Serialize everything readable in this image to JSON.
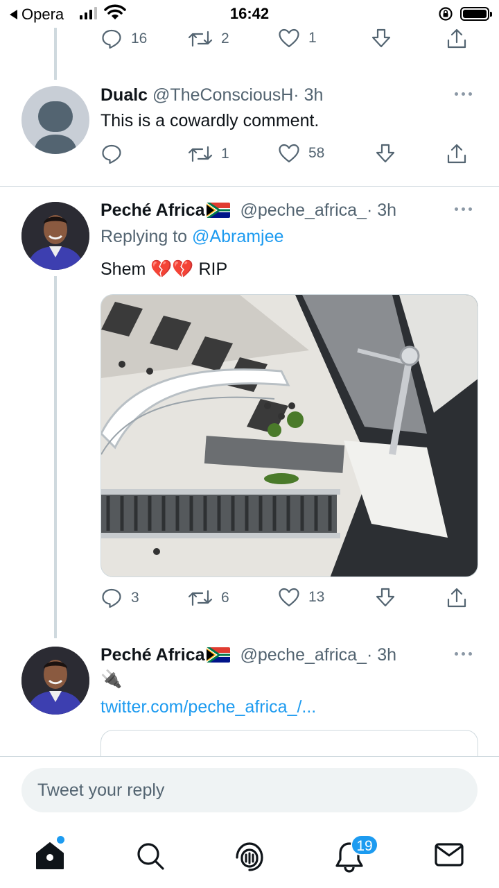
{
  "status_bar": {
    "back_app": "Opera",
    "time": "16:42"
  },
  "colors": {
    "accent": "#1d9bf0",
    "secondary_text": "#536471",
    "divider": "#cfd9de"
  },
  "prev_tweet_actions": {
    "replies": "16",
    "retweets": "2",
    "likes": "1"
  },
  "tweets": [
    {
      "name": "Dualc",
      "handle": "@TheConsciousH",
      "time": "· 3h",
      "text": "This is a cowardly comment.",
      "replies": "",
      "retweets": "1",
      "likes": "58",
      "avatar": "default-avatar"
    },
    {
      "name": "Peché Africa",
      "flag": "south-africa-flag",
      "handle": "@peche_africa_",
      "time": "· 3h",
      "replying_label": "Replying to",
      "replying_to": "@Abramjee",
      "text": "Shem 💔💔 RIP",
      "replies": "3",
      "retweets": "6",
      "likes": "13",
      "media": "photo of mall escalators from above"
    },
    {
      "name": "Peché Africa",
      "flag": "south-africa-flag",
      "handle": "@peche_africa_",
      "time": "· 3h",
      "text": "🔌",
      "link": "twitter.com/peche_africa_/..."
    }
  ],
  "reply_composer": {
    "placeholder": "Tweet your reply"
  },
  "bottom_nav": {
    "items": [
      "home-icon",
      "search-icon",
      "spaces-icon",
      "notifications-icon",
      "messages-icon"
    ],
    "notifications_badge": "19"
  }
}
